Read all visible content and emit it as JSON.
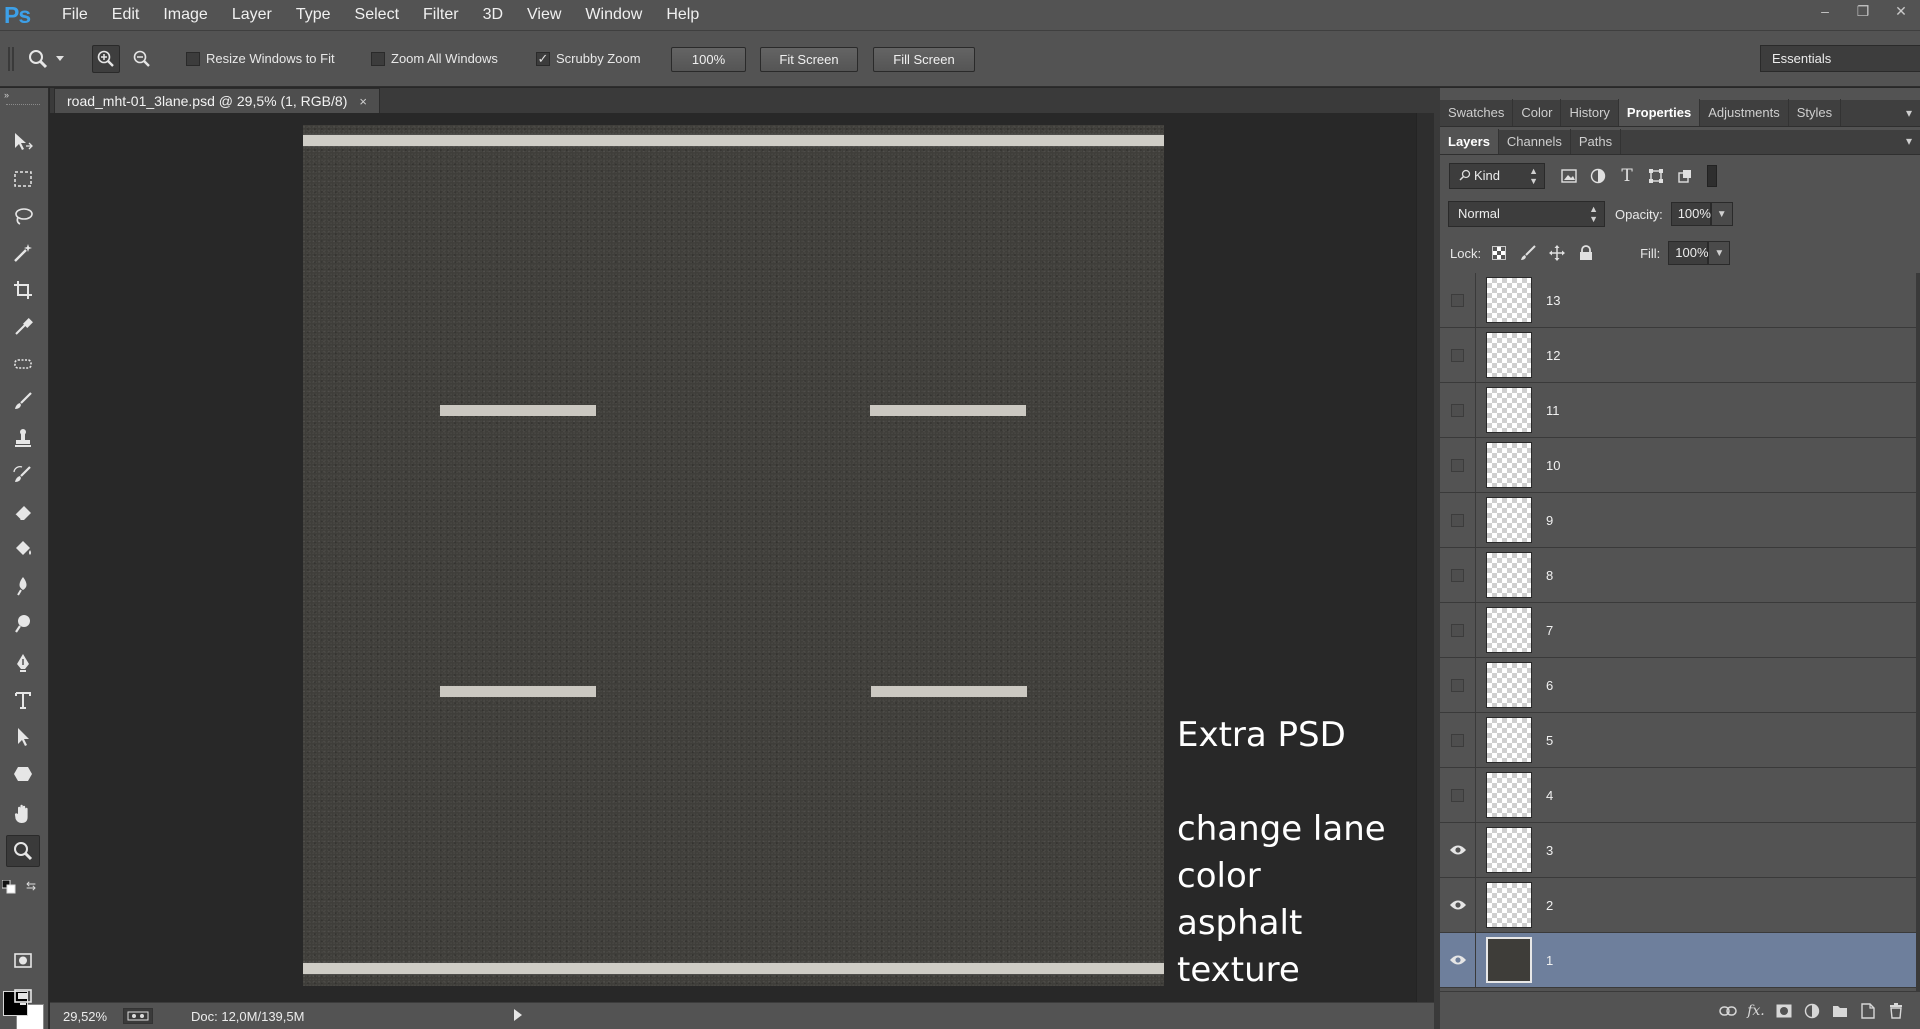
{
  "app": {
    "logo": "Ps"
  },
  "menu": [
    "File",
    "Edit",
    "Image",
    "Layer",
    "Type",
    "Select",
    "Filter",
    "3D",
    "View",
    "Window",
    "Help"
  ],
  "window_controls": {
    "minimize": "–",
    "restore": "❐",
    "close": "✕"
  },
  "options": {
    "resize_windows": {
      "label": "Resize Windows to Fit",
      "checked": false
    },
    "zoom_all": {
      "label": "Zoom All Windows",
      "checked": false
    },
    "scrubby_zoom": {
      "label": "Scrubby Zoom",
      "checked": true
    },
    "btn_100": "100%",
    "btn_fit": "Fit Screen",
    "btn_fill": "Fill Screen",
    "workspace": "Essentials"
  },
  "document": {
    "tab_title": "road_mht-01_3lane.psd @ 29,5% (1, RGB/8)",
    "close": "×",
    "annotation_title": "Extra PSD",
    "annotation_lines": [
      "change lane",
      "color",
      "asphalt",
      "texture"
    ]
  },
  "status": {
    "zoom": "29,52%",
    "doc": "Doc: 12,0M/139,5M"
  },
  "panels": {
    "top_tabs": [
      "Swatches",
      "Color",
      "History",
      "Properties",
      "Adjustments",
      "Styles"
    ],
    "top_active": "Properties",
    "layer_tabs": [
      "Layers",
      "Channels",
      "Paths"
    ],
    "layer_active": "Layers",
    "kind": "Kind",
    "blend_mode": "Normal",
    "opacity_label": "Opacity:",
    "opacity_value": "100%",
    "lock_label": "Lock:",
    "fill_label": "Fill:",
    "fill_value": "100%"
  },
  "layers": [
    {
      "name": "13",
      "visible": false,
      "selected": false,
      "thumb": "transparent"
    },
    {
      "name": "12",
      "visible": false,
      "selected": false,
      "thumb": "transparent"
    },
    {
      "name": "11",
      "visible": false,
      "selected": false,
      "thumb": "transparent"
    },
    {
      "name": "10",
      "visible": false,
      "selected": false,
      "thumb": "transparent"
    },
    {
      "name": "9",
      "visible": false,
      "selected": false,
      "thumb": "transparent"
    },
    {
      "name": "8",
      "visible": false,
      "selected": false,
      "thumb": "transparent"
    },
    {
      "name": "7",
      "visible": false,
      "selected": false,
      "thumb": "transparent"
    },
    {
      "name": "6",
      "visible": false,
      "selected": false,
      "thumb": "transparent"
    },
    {
      "name": "5",
      "visible": false,
      "selected": false,
      "thumb": "transparent"
    },
    {
      "name": "4",
      "visible": false,
      "selected": false,
      "thumb": "transparent"
    },
    {
      "name": "3",
      "visible": true,
      "selected": false,
      "thumb": "transparent"
    },
    {
      "name": "2",
      "visible": true,
      "selected": false,
      "thumb": "transparent"
    },
    {
      "name": "1",
      "visible": true,
      "selected": true,
      "thumb": "asphalt"
    }
  ],
  "colors": {
    "accent_selected": "#6e7f9c",
    "ps_blue": "#3da0e8",
    "ui_gray": "#535353"
  }
}
